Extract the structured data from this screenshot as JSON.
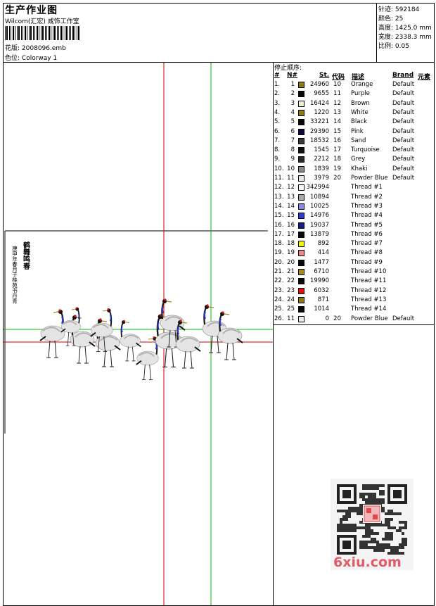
{
  "header": {
    "title": "生产作业图",
    "company": "Wilcom(汇宏) 咸饰工作室",
    "design_label": "花版:",
    "design_value": "2008096.emb",
    "colorway_label": "色位:",
    "colorway_value": "Colorway 1"
  },
  "stats": [
    {
      "label": "针迹:",
      "value": "592184"
    },
    {
      "label": "颜色:",
      "value": "25"
    },
    {
      "label": "高度:",
      "value": "1425.0 mm"
    },
    {
      "label": "宽度:",
      "value": "2338.3 mm"
    },
    {
      "label": "比例:",
      "value": "0.05"
    }
  ],
  "design": {
    "vertical_text_1": "鹤舞鸣春",
    "vertical_text_2": "庚申年春月于桂苑书丹青",
    "crane_count": 12
  },
  "sequence": {
    "title": "停止顺序:",
    "headers": {
      "idx": "#",
      "n": "N#",
      "st": "St.",
      "code": "代码",
      "desc": "描述",
      "brand": "Brand",
      "elem": "元素"
    },
    "rows": [
      {
        "idx": "1.",
        "n": "1",
        "color": "#8a7a18",
        "st": "24960",
        "code": "10",
        "desc": "Orange",
        "brand": "Default"
      },
      {
        "idx": "2.",
        "n": "2",
        "color": "#0a0a0a",
        "st": "9655",
        "code": "11",
        "desc": "Purple",
        "brand": "Default"
      },
      {
        "idx": "3.",
        "n": "3",
        "color": "#f0f0dc",
        "st": "16424",
        "code": "12",
        "desc": "Brown",
        "brand": "Default"
      },
      {
        "idx": "4.",
        "n": "4",
        "color": "#8a7a18",
        "st": "1220",
        "code": "13",
        "desc": "White",
        "brand": "Default"
      },
      {
        "idx": "5.",
        "n": "5",
        "color": "#0a0a0a",
        "st": "33221",
        "code": "14",
        "desc": "Black",
        "brand": "Default"
      },
      {
        "idx": "6.",
        "n": "6",
        "color": "#0a0a3c",
        "st": "29390",
        "code": "15",
        "desc": "Pink",
        "brand": "Default"
      },
      {
        "idx": "7.",
        "n": "7",
        "color": "#3a3a3a",
        "st": "18532",
        "code": "16",
        "desc": "Sand",
        "brand": "Default"
      },
      {
        "idx": "8.",
        "n": "8",
        "color": "#111111",
        "st": "1545",
        "code": "17",
        "desc": "Turquoise",
        "brand": "Default"
      },
      {
        "idx": "9.",
        "n": "9",
        "color": "#2a2a2a",
        "st": "2212",
        "code": "18",
        "desc": "Grey",
        "brand": "Default"
      },
      {
        "idx": "10.",
        "n": "10",
        "color": "#8a8a8a",
        "st": "1839",
        "code": "19",
        "desc": "Khaki",
        "brand": "Default"
      },
      {
        "idx": "11.",
        "n": "11",
        "color": "#e6e6e6",
        "st": "3979",
        "code": "20",
        "desc": "Powder Blue",
        "brand": "Default"
      },
      {
        "idx": "12.",
        "n": "12",
        "color": "#f6f6f6",
        "st": "342994",
        "code": "",
        "desc": "Thread #1",
        "brand": ""
      },
      {
        "idx": "13.",
        "n": "13",
        "color": "#aaaaaa",
        "st": "10894",
        "code": "",
        "desc": "Thread #2",
        "brand": ""
      },
      {
        "idx": "14.",
        "n": "14",
        "color": "#8a8ae6",
        "st": "10025",
        "code": "",
        "desc": "Thread #3",
        "brand": ""
      },
      {
        "idx": "15.",
        "n": "15",
        "color": "#2a3ad0",
        "st": "14976",
        "code": "",
        "desc": "Thread #4",
        "brand": ""
      },
      {
        "idx": "16.",
        "n": "16",
        "color": "#1a1a8a",
        "st": "19037",
        "code": "",
        "desc": "Thread #5",
        "brand": ""
      },
      {
        "idx": "17.",
        "n": "17",
        "color": "#0a0a0a",
        "st": "13879",
        "code": "",
        "desc": "Thread #6",
        "brand": ""
      },
      {
        "idx": "18.",
        "n": "18",
        "color": "#f6f600",
        "st": "892",
        "code": "",
        "desc": "Thread #7",
        "brand": ""
      },
      {
        "idx": "19.",
        "n": "19",
        "color": "#e88a8a",
        "st": "414",
        "code": "",
        "desc": "Thread #8",
        "brand": ""
      },
      {
        "idx": "20.",
        "n": "20",
        "color": "#0a0a0a",
        "st": "1477",
        "code": "",
        "desc": "Thread #9",
        "brand": ""
      },
      {
        "idx": "21.",
        "n": "21",
        "color": "#a88a1a",
        "st": "6710",
        "code": "",
        "desc": "Thread #10",
        "brand": ""
      },
      {
        "idx": "22.",
        "n": "22",
        "color": "#0a0a0a",
        "st": "19990",
        "code": "",
        "desc": "Thread #11",
        "brand": ""
      },
      {
        "idx": "23.",
        "n": "23",
        "color": "#e01010",
        "st": "6032",
        "code": "",
        "desc": "Thread #12",
        "brand": ""
      },
      {
        "idx": "24.",
        "n": "24",
        "color": "#8a7a18",
        "st": "871",
        "code": "",
        "desc": "Thread #13",
        "brand": ""
      },
      {
        "idx": "25.",
        "n": "25",
        "color": "#0a0a0a",
        "st": "1014",
        "code": "",
        "desc": "Thread #14",
        "brand": ""
      },
      {
        "idx": "26.",
        "n": "11",
        "color": "#ececec",
        "st": "0",
        "code": "20",
        "desc": "Powder Blue",
        "brand": "Default"
      }
    ]
  },
  "watermark": {
    "text": "6xiu.com"
  }
}
